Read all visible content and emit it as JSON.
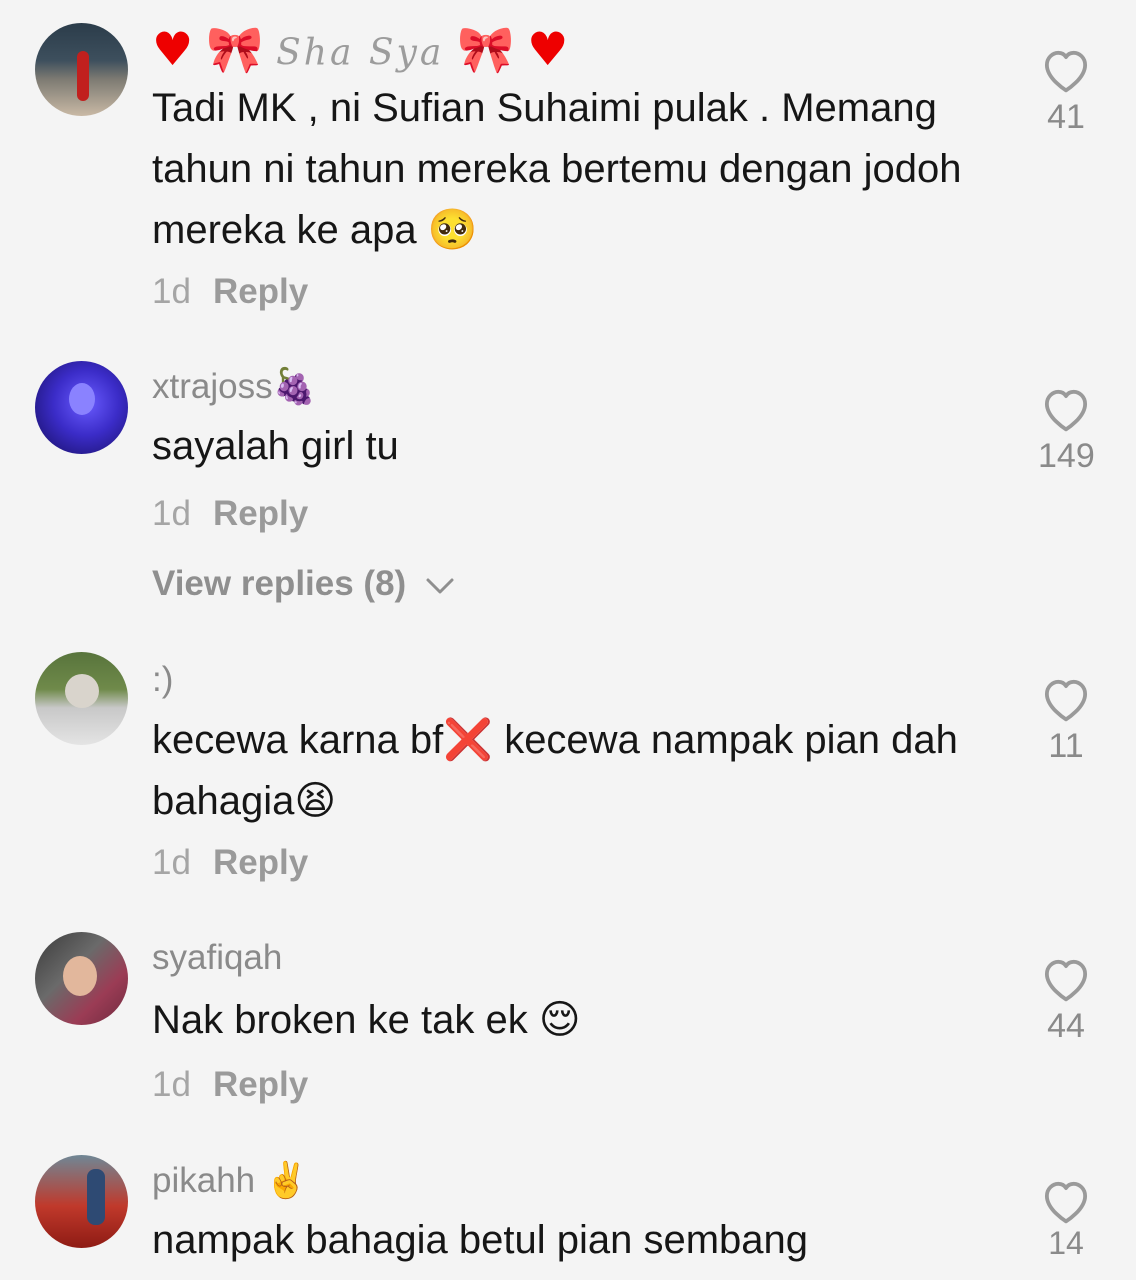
{
  "comments": [
    {
      "username_decor": "♥ 🎀 Sha Sya 🎀 ♥",
      "text": "Tadi MK , ni Sufian Suhaimi pulak . Memang tahun ni tahun mereka bertemu dengan jodoh mereka ke apa 🥺",
      "time": "1d",
      "reply_label": "Reply",
      "likes": "41"
    },
    {
      "username": "xtrajoss",
      "username_emoji": "🍇",
      "text": "sayalah girl tu",
      "time": "1d",
      "reply_label": "Reply",
      "likes": "149",
      "view_replies": "View replies (8)"
    },
    {
      "username": ":)",
      "text": "kecewa karna bf❌ kecewa nampak pian dah bahagia😫",
      "time": "1d",
      "reply_label": "Reply",
      "likes": "11"
    },
    {
      "username": "syafiqah",
      "text": "Nak broken ke tak ek 😌",
      "time": "1d",
      "reply_label": "Reply",
      "likes": "44"
    },
    {
      "username": "pikahh",
      "username_emoji": "✌️",
      "text": "nampak bahagia betul pian sembang",
      "likes": "14"
    }
  ],
  "icons": {
    "like": "heart-outline-icon",
    "expand": "chevron-down-icon"
  },
  "colors": {
    "background": "#f4f4f4",
    "text": "#161616",
    "secondary": "#8a8a8a"
  }
}
